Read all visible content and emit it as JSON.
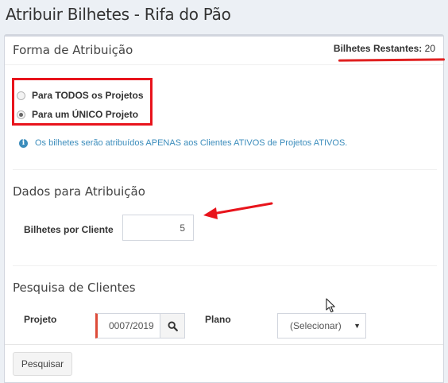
{
  "page": {
    "title": "Atribuir Bilhetes - Rifa do Pão"
  },
  "assignment_form": {
    "heading": "Forma de Atribuição",
    "remaining_label": "Bilhetes Restantes:",
    "remaining_value": "20",
    "options": [
      {
        "label": "Para TODOS os Projetos",
        "checked": false
      },
      {
        "label": "Para um ÚNICO Projeto",
        "checked": true
      }
    ],
    "info_icon": "info-circle-icon",
    "info_text": "Os bilhetes serão atribuídos APENAS aos Clientes ATIVOS de Projetos ATIVOS."
  },
  "assignment_data": {
    "heading": "Dados para Atribuição",
    "tickets_label": "Bilhetes por Cliente",
    "tickets_value": "5"
  },
  "client_search": {
    "heading": "Pesquisa de Clientes",
    "project_label": "Projeto",
    "project_value": "0007/2019",
    "search_icon": "magnifier-icon",
    "plan_label": "Plano",
    "plan_selected": "(Selecionar)",
    "caret_icon": "▼",
    "submit_label": "Pesquisar"
  },
  "annotations": {
    "highlight_color": "#e8141c"
  }
}
